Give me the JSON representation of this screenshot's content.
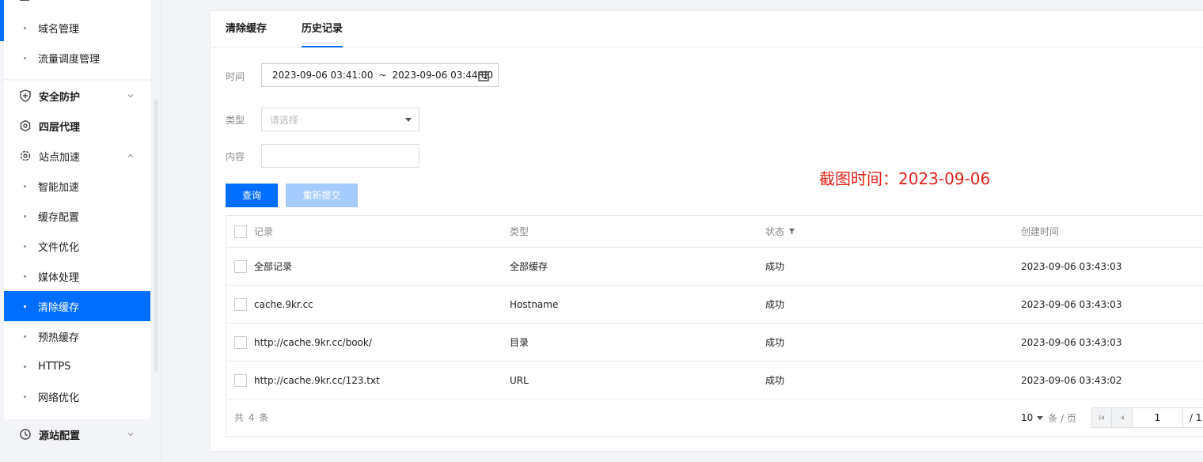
{
  "sidebar": {
    "top_items": [
      {
        "label": "域名管理"
      },
      {
        "label": "流量调度管理"
      }
    ],
    "groups": {
      "security": {
        "label": "安全防护",
        "icon": "shield-icon"
      },
      "l4proxy": {
        "label": "四层代理",
        "icon": "hexagon-icon"
      },
      "site_accel": {
        "label": "站点加速",
        "icon": "gear-icon"
      },
      "origin": {
        "label": "源站配置",
        "icon": "history-icon"
      }
    },
    "accel_items": [
      {
        "label": "智能加速"
      },
      {
        "label": "缓存配置"
      },
      {
        "label": "文件优化"
      },
      {
        "label": "媒体处理"
      },
      {
        "label": "清除缓存",
        "active": true
      },
      {
        "label": "预热缓存"
      },
      {
        "label": "HTTPS"
      },
      {
        "label": "网络优化"
      }
    ],
    "accent_color": "#006eff"
  },
  "tabs": [
    {
      "label": "清除缓存"
    },
    {
      "label": "历史记录",
      "active": true
    }
  ],
  "form": {
    "time_label": "时间",
    "time_start": "2023-09-06 03:41:00",
    "time_sep": "~",
    "time_end": "2023-09-06 03:44:00",
    "type_label": "类型",
    "type_placeholder": "请选择",
    "content_label": "内容",
    "content_value": ""
  },
  "buttons": {
    "query": "查询",
    "resubmit": "重新提交"
  },
  "annotation": "截图时间：2023-09-06",
  "table": {
    "headers": {
      "record": "记录",
      "type": "类型",
      "status": "状态",
      "created": "创建时间"
    },
    "rows": [
      {
        "record": "全部记录",
        "type": "全部缓存",
        "status": "成功",
        "created": "2023-09-06 03:43:03"
      },
      {
        "record": "cache.9kr.cc",
        "type": "Hostname",
        "status": "成功",
        "created": "2023-09-06 03:43:03"
      },
      {
        "record": "http://cache.9kr.cc/book/",
        "type": "目录",
        "status": "成功",
        "created": "2023-09-06 03:43:03"
      },
      {
        "record": "http://cache.9kr.cc/123.txt",
        "type": "URL",
        "status": "成功",
        "created": "2023-09-06 03:43:02"
      }
    ]
  },
  "pagination": {
    "total_text": "共 4 条",
    "page_size": "10",
    "page_size_unit": "条 / 页",
    "current_page": "1",
    "total_pages": "/ 1"
  }
}
